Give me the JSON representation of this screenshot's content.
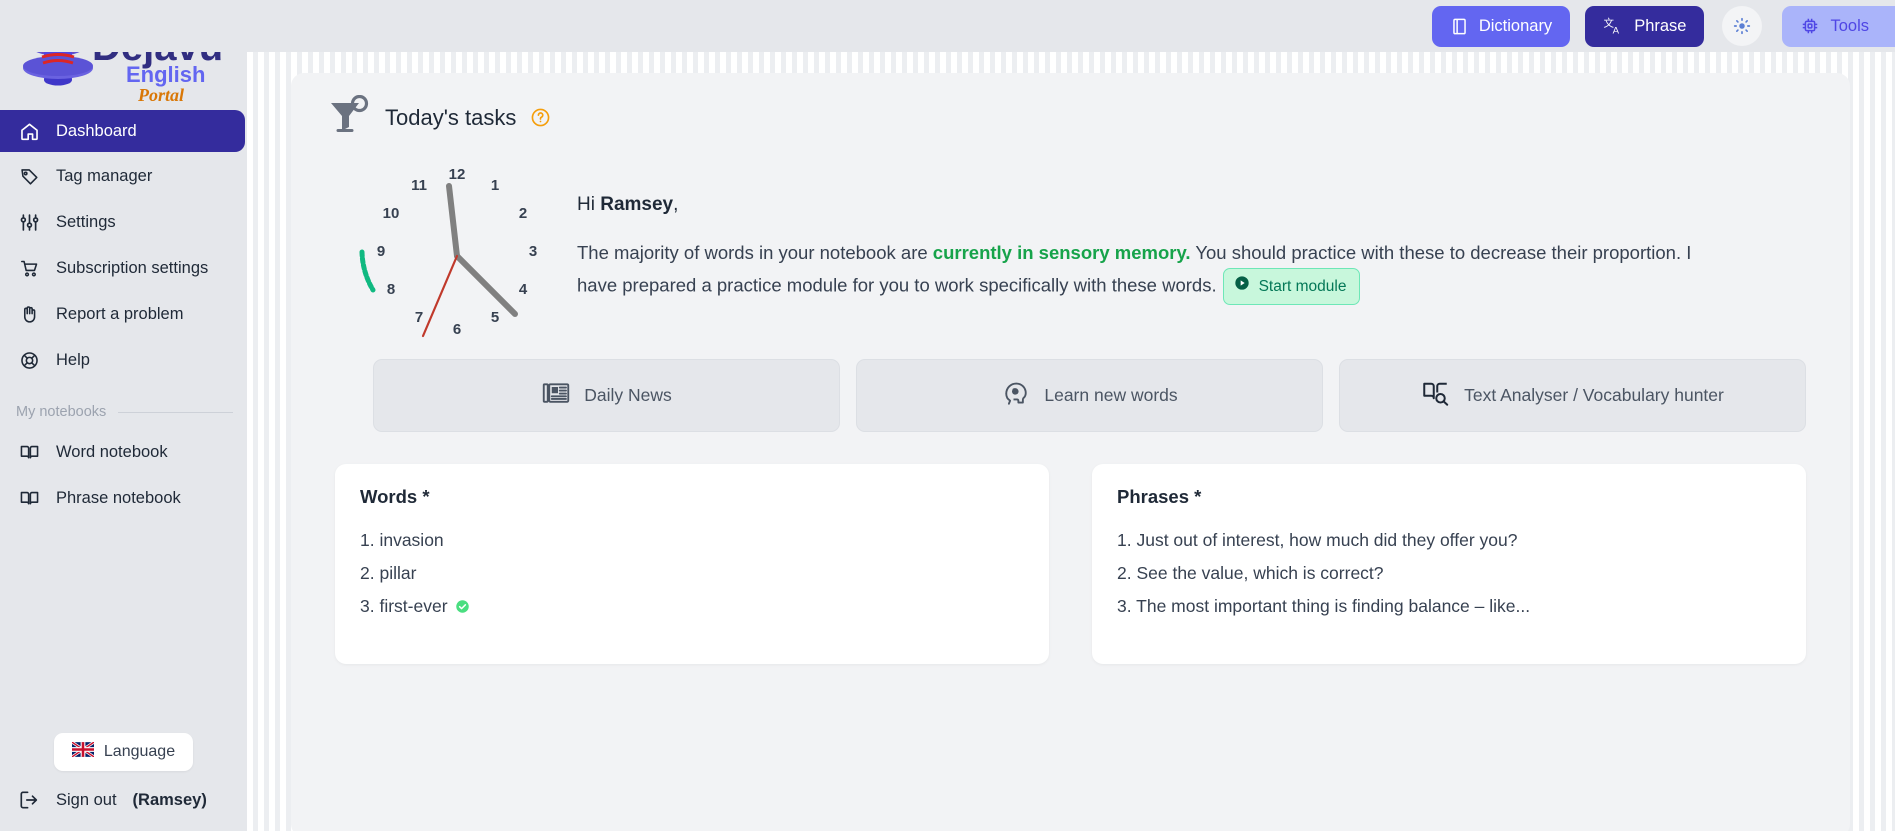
{
  "brand": {
    "name": "Dejavu",
    "line2": "English",
    "line3": "Portal"
  },
  "colors": {
    "accent": "#342c9d",
    "indigo": "#6366f1",
    "tools_bg": "#aab4fa",
    "green": "#16a34a",
    "start_bg": "#c8f7dc",
    "sidebar_bg": "#e5e7eb",
    "panel_bg": "#f2f3f5"
  },
  "topbar": {
    "buttons": [
      {
        "label": "Dictionary",
        "icon": "book-icon"
      },
      {
        "label": "Phrase",
        "icon": "translate-icon"
      },
      {
        "label": "",
        "icon": "brightness-icon"
      },
      {
        "label": "Tools",
        "icon": "chip-icon"
      }
    ]
  },
  "sidebar": {
    "items": [
      {
        "label": "Dashboard",
        "icon": "home-icon",
        "active": true
      },
      {
        "label": "Tag manager",
        "icon": "tag-icon",
        "active": false
      },
      {
        "label": "Settings",
        "icon": "sliders-icon",
        "active": false
      },
      {
        "label": "Subscription settings",
        "icon": "cart-icon",
        "active": false
      },
      {
        "label": "Report a problem",
        "icon": "hand-icon",
        "active": false
      },
      {
        "label": "Help",
        "icon": "lifebuoy-icon",
        "active": false
      }
    ],
    "section_title": "My notebooks",
    "notebooks": [
      {
        "label": "Word notebook",
        "icon": "book-open-icon"
      },
      {
        "label": "Phrase notebook",
        "icon": "book-open-icon"
      }
    ],
    "language_button": {
      "label": "Language",
      "icon": "uk-flag-icon"
    },
    "signout": {
      "label": "Sign out",
      "user": "(Ramsey)",
      "icon": "logout-icon"
    }
  },
  "main": {
    "page_title": "Today's tasks",
    "title_icon": "funnel-icon",
    "help_icon": "question-circle-icon",
    "greeting_prefix": "Hi ",
    "greeting_name": "Ramsey",
    "greeting_suffix": ",",
    "paragraph_part1": "The majority of words in your notebook are ",
    "paragraph_highlight": "currently in sensory memory.",
    "paragraph_part2": " You should practice with these to decrease their proportion. I have prepared a practice module for you to work specifically with these words.",
    "start_module_label": "Start module",
    "start_module_icon": "play-circle-icon",
    "action_cards": [
      {
        "label": "Daily News",
        "icon": "newspaper-icon"
      },
      {
        "label": "Learn new words",
        "icon": "brain-head-icon"
      },
      {
        "label": "Text Analyser / Vocabulary hunter",
        "icon": "book-search-icon"
      }
    ],
    "words_card": {
      "title": "Words *",
      "items": [
        {
          "text": "1. invasion",
          "done": false
        },
        {
          "text": "2. pillar",
          "done": false
        },
        {
          "text": "3. first-ever",
          "done": true
        }
      ]
    },
    "phrases_card": {
      "title": "Phrases *",
      "items": [
        {
          "text": "1. Just out of interest, how much did they offer you?",
          "done": false
        },
        {
          "text": "2. See the value, which is correct?",
          "done": false
        },
        {
          "text": "3. The most important thing is finding balance – like...",
          "done": false
        }
      ]
    }
  },
  "clock": {
    "numerals": [
      "1",
      "2",
      "3",
      "4",
      "5",
      "6",
      "7",
      "8",
      "9",
      "10",
      "11",
      "12"
    ],
    "hour_hand_target": "5",
    "minute_hand_target": "12",
    "second_hand_target": "7",
    "progress_arc_color": "#10b981",
    "hand_color": "#808080",
    "second_hand_color": "#c0392b"
  }
}
